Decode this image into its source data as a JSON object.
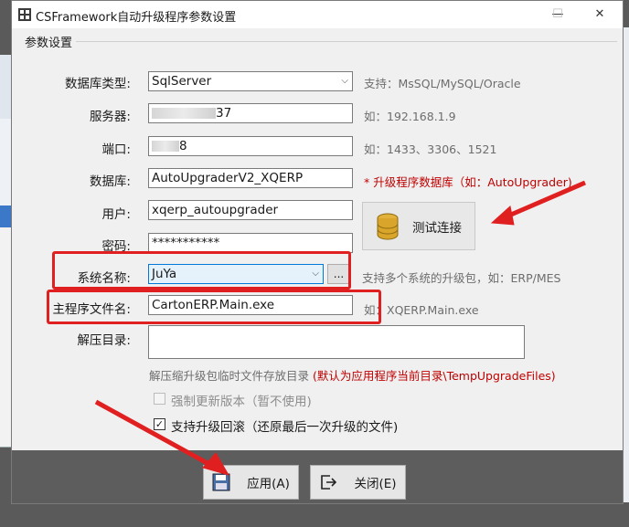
{
  "window": {
    "title": "CSFramework自动升级程序参数设置"
  },
  "group": {
    "title": "参数设置"
  },
  "fields": {
    "db_type": {
      "label": "数据库类型:",
      "value": "SqlServer",
      "hint": "支持：MsSQL/MySQL/Oracle"
    },
    "server": {
      "label": "服务器:",
      "value": "37",
      "hint": "如：192.168.1.9"
    },
    "port": {
      "label": "端口:",
      "value": "8",
      "hint": "如：1433、3306、1521"
    },
    "database": {
      "label": "数据库:",
      "value": "AutoUpgraderV2_XQERP",
      "hint": "* 升级程序数据库（如：AutoUpgrader)"
    },
    "user": {
      "label": "用户:",
      "value": "xqerp_autoupgrader"
    },
    "password": {
      "label": "密码:",
      "value": "***********"
    },
    "system": {
      "label": "系统名称:",
      "value": "JuYa",
      "browse": "...",
      "hint": "支持多个系统的升级包，如：ERP/MES"
    },
    "main_exe": {
      "label": "主程序文件名:",
      "value": "CartonERP.Main.exe",
      "hint": "如：XQERP.Main.exe"
    },
    "extract": {
      "label": "解压目录:",
      "value": ""
    }
  },
  "extract_hint": {
    "gray": "解压缩升级包临时文件存放目录",
    "red": "(默认为应用程序当前目录\\TempUpgradeFiles)"
  },
  "test_button": {
    "label": "测试连接"
  },
  "checkboxes": {
    "force": {
      "label": "强制更新版本（暂不使用)",
      "checked": false
    },
    "rollback": {
      "label": "支持升级回滚（还原最后一次升级的文件)",
      "checked": true,
      "mark": "✓"
    }
  },
  "buttons": {
    "apply": "应用(A)",
    "close": "关闭(E)"
  },
  "title_controls": {
    "minimize": "—",
    "maximize": "☐",
    "close": "✕"
  },
  "colors": {
    "highlight_red": "#e02020",
    "accent_blue": "#0078d7"
  }
}
